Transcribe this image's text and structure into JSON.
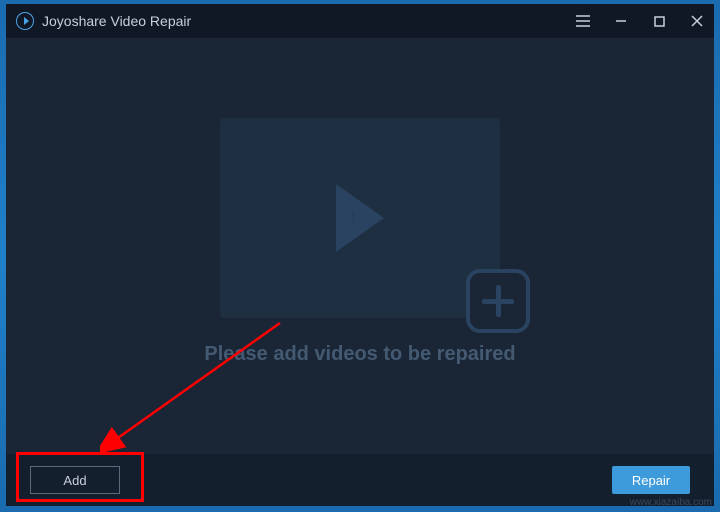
{
  "titlebar": {
    "app_name": "Joyoshare Video Repair"
  },
  "main": {
    "instruction": "Please add videos to be repaired"
  },
  "footer": {
    "add_label": "Add",
    "repair_label": "Repair"
  },
  "watermark": "www.xiazaiba.com"
}
